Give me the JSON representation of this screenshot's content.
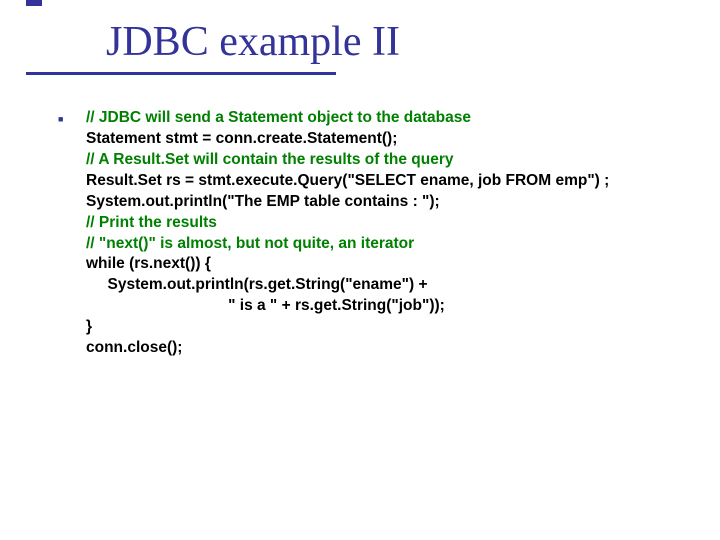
{
  "title": "JDBC example II",
  "code": {
    "l1": "// JDBC will send a Statement object to the database",
    "l2": "Statement stmt = conn.create.Statement();",
    "l3": "// A Result.Set will contain the results of the query",
    "l4": "Result.Set rs = stmt.execute.Query(\"SELECT ename, job FROM emp\") ;",
    "l5": "System.out.println(\"The EMP table contains : \");",
    "l6": "// Print the results",
    "l7": "// \"next()\" is almost, but not quite, an iterator",
    "l8": "while (rs.next()) {",
    "l9": "     System.out.println(rs.get.String(\"ename\") +",
    "l10": "                                 \" is a \" + rs.get.String(\"job\"));",
    "l11": "}",
    "l12": "conn.close();"
  }
}
